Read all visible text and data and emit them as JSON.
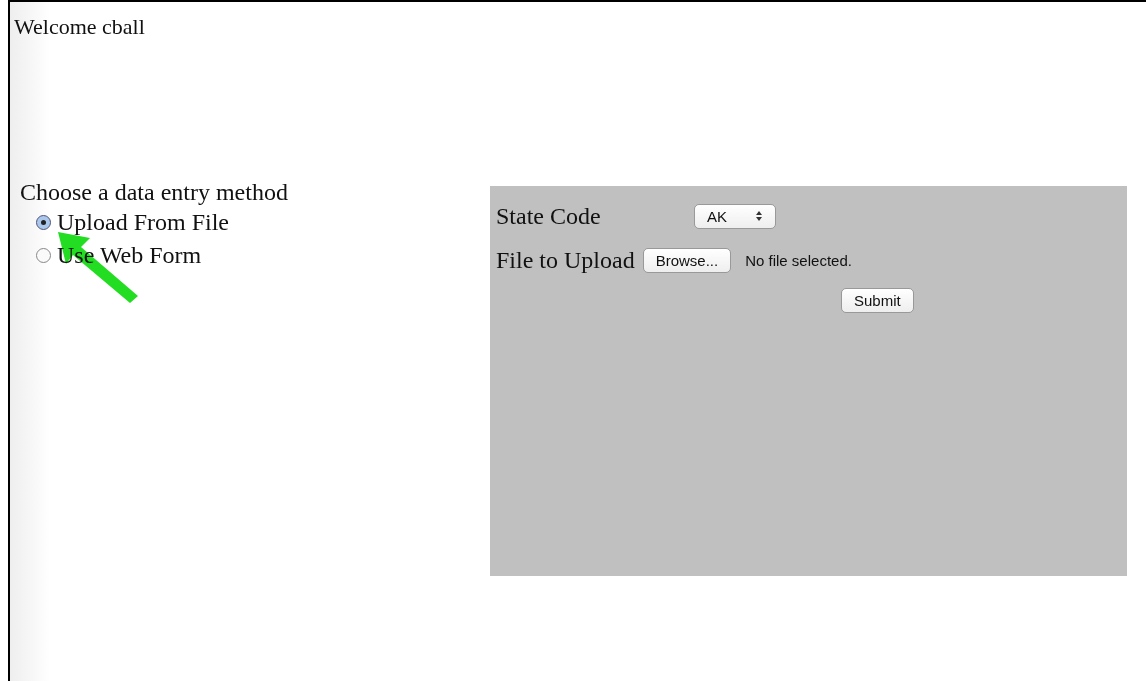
{
  "greeting": "Welcome cball",
  "method": {
    "label": "Choose a data entry method",
    "options": [
      {
        "label": "Upload From File",
        "selected": true
      },
      {
        "label": "Use Web Form",
        "selected": false
      }
    ]
  },
  "form": {
    "state_code": {
      "label": "State Code",
      "value": "AK"
    },
    "file": {
      "label": "File to Upload",
      "button": "Browse...",
      "status": "No file selected."
    },
    "submit": "Submit"
  }
}
